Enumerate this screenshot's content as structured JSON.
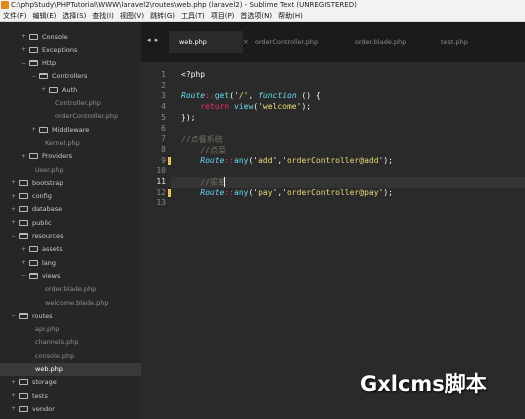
{
  "window": {
    "title": "C:\\phpStudy\\PHPTutorial\\WWW\\laravel2\\routes\\web.php (laravel2) - Sublime Text (UNREGISTERED)"
  },
  "menu": [
    "文件(F)",
    "编辑(E)",
    "选择(S)",
    "查找(I)",
    "视图(V)",
    "跳转(G)",
    "工具(T)",
    "项目(P)",
    "首选项(N)",
    "帮助(H)"
  ],
  "sidebar": {
    "items": [
      {
        "label": "Console",
        "kind": "folder",
        "state": "collapsed",
        "depth": 1
      },
      {
        "label": "Exceptions",
        "kind": "folder",
        "state": "collapsed",
        "depth": 1
      },
      {
        "label": "Http",
        "kind": "folder",
        "state": "expanded",
        "depth": 1
      },
      {
        "label": "Controllers",
        "kind": "folder",
        "state": "expanded",
        "depth": 2
      },
      {
        "label": "Auth",
        "kind": "folder",
        "state": "collapsed",
        "depth": 3
      },
      {
        "label": "Controller.php",
        "kind": "file",
        "depth": 3
      },
      {
        "label": "orderController.php",
        "kind": "file",
        "depth": 3
      },
      {
        "label": "Middleware",
        "kind": "folder",
        "state": "collapsed",
        "depth": 2
      },
      {
        "label": "Kernel.php",
        "kind": "file",
        "depth": 2
      },
      {
        "label": "Providers",
        "kind": "folder",
        "state": "collapsed",
        "depth": 1
      },
      {
        "label": "User.php",
        "kind": "file",
        "depth": 1
      },
      {
        "label": "bootstrap",
        "kind": "folder",
        "state": "collapsed",
        "depth": 0
      },
      {
        "label": "config",
        "kind": "folder",
        "state": "collapsed",
        "depth": 0
      },
      {
        "label": "database",
        "kind": "folder",
        "state": "collapsed",
        "depth": 0
      },
      {
        "label": "public",
        "kind": "folder",
        "state": "collapsed",
        "depth": 0
      },
      {
        "label": "resources",
        "kind": "folder",
        "state": "expanded",
        "depth": 0
      },
      {
        "label": "assets",
        "kind": "folder",
        "state": "collapsed",
        "depth": 1
      },
      {
        "label": "lang",
        "kind": "folder",
        "state": "collapsed",
        "depth": 1
      },
      {
        "label": "views",
        "kind": "folder",
        "state": "expanded",
        "depth": 1
      },
      {
        "label": "order.blade.php",
        "kind": "file",
        "depth": 2
      },
      {
        "label": "welcome.blade.php",
        "kind": "file",
        "depth": 2
      },
      {
        "label": "routes",
        "kind": "folder",
        "state": "expanded",
        "depth": 0
      },
      {
        "label": "api.php",
        "kind": "file",
        "depth": 1
      },
      {
        "label": "channels.php",
        "kind": "file",
        "depth": 1
      },
      {
        "label": "console.php",
        "kind": "file",
        "depth": 1
      },
      {
        "label": "web.php",
        "kind": "file",
        "depth": 1,
        "active": true
      },
      {
        "label": "storage",
        "kind": "folder",
        "state": "collapsed",
        "depth": 0
      },
      {
        "label": "tests",
        "kind": "folder",
        "state": "collapsed",
        "depth": 0
      },
      {
        "label": "vendor",
        "kind": "folder",
        "state": "collapsed",
        "depth": 0
      }
    ]
  },
  "tabs": {
    "nav_arrows": "◂ ▸",
    "items": [
      {
        "label": "web.php",
        "active": true
      },
      {
        "label": "orderController.php",
        "active": false
      },
      {
        "label": "order.blade.php",
        "active": false
      },
      {
        "label": "test.php",
        "active": false
      }
    ],
    "close_glyph": "×"
  },
  "editor": {
    "current_line": 11,
    "modified_lines": [
      9,
      12
    ],
    "lines": [
      {
        "n": "1",
        "tokens": [
          {
            "t": "<?php",
            "c": ""
          }
        ]
      },
      {
        "n": "2",
        "tokens": []
      },
      {
        "n": "3",
        "tokens": [
          {
            "t": "Route",
            "c": "k-cls"
          },
          {
            "t": "::",
            "c": "k-op"
          },
          {
            "t": "get",
            "c": "k-fn"
          },
          {
            "t": "('",
            "c": ""
          },
          {
            "t": "/",
            "c": "k-str"
          },
          {
            "t": "', ",
            "c": ""
          },
          {
            "t": "function",
            "c": "k-kw"
          },
          {
            "t": " () {",
            "c": ""
          }
        ]
      },
      {
        "n": "4",
        "tokens": [
          {
            "t": "    ",
            "c": ""
          },
          {
            "t": "return",
            "c": "k-ret"
          },
          {
            "t": " ",
            "c": ""
          },
          {
            "t": "view",
            "c": "k-fn"
          },
          {
            "t": "('",
            "c": ""
          },
          {
            "t": "welcome",
            "c": "k-str"
          },
          {
            "t": "');",
            "c": ""
          }
        ]
      },
      {
        "n": "5",
        "tokens": [
          {
            "t": "});",
            "c": ""
          }
        ]
      },
      {
        "n": "6",
        "tokens": []
      },
      {
        "n": "7",
        "tokens": [
          {
            "t": "//点餐系统",
            "c": "k-com"
          }
        ]
      },
      {
        "n": "8",
        "tokens": [
          {
            "t": "    ",
            "c": ""
          },
          {
            "t": "//点菜",
            "c": "k-com"
          }
        ]
      },
      {
        "n": "9",
        "tokens": [
          {
            "t": "    ",
            "c": ""
          },
          {
            "t": "Route",
            "c": "k-cls"
          },
          {
            "t": "::",
            "c": "k-op"
          },
          {
            "t": "any",
            "c": "k-fn"
          },
          {
            "t": "('",
            "c": ""
          },
          {
            "t": "add",
            "c": "k-str"
          },
          {
            "t": "','",
            "c": ""
          },
          {
            "t": "orderController@add",
            "c": "k-str"
          },
          {
            "t": "');",
            "c": ""
          }
        ]
      },
      {
        "n": "10",
        "tokens": []
      },
      {
        "n": "11",
        "tokens": [
          {
            "t": "    ",
            "c": ""
          },
          {
            "t": "//买单",
            "c": "k-com"
          }
        ]
      },
      {
        "n": "12",
        "tokens": [
          {
            "t": "    ",
            "c": ""
          },
          {
            "t": "Route",
            "c": "k-cls"
          },
          {
            "t": "::",
            "c": "k-op"
          },
          {
            "t": "any",
            "c": "k-fn"
          },
          {
            "t": "('",
            "c": ""
          },
          {
            "t": "pay",
            "c": "k-str"
          },
          {
            "t": "','",
            "c": ""
          },
          {
            "t": "orderController@pay",
            "c": "k-str"
          },
          {
            "t": "');",
            "c": ""
          }
        ]
      },
      {
        "n": "13",
        "tokens": []
      }
    ]
  },
  "watermark": {
    "text": "Gxlcms脚本"
  }
}
